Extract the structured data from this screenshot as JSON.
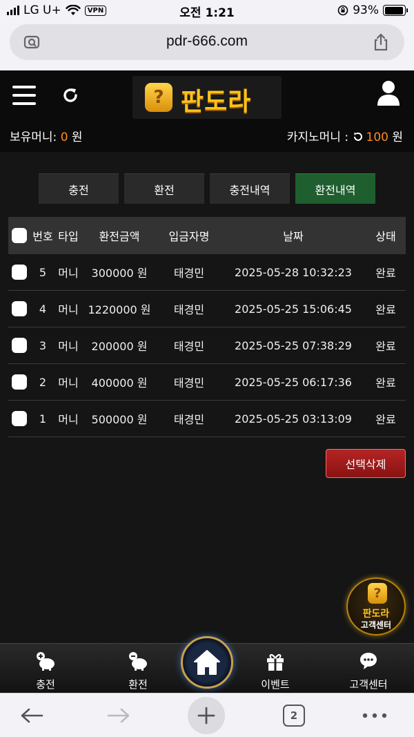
{
  "status_bar": {
    "carrier": "LG U+",
    "vpn": "VPN",
    "time": "오전 1:21",
    "battery_pct": "93%",
    "battery_level": 0.93
  },
  "browser": {
    "url": "pdr-666.com",
    "tab_count": "2"
  },
  "header": {
    "logo_text": "판도라",
    "logo_mark": "?",
    "wallet_label": "보유머니: ",
    "wallet_value": "0",
    "wallet_unit": " 원",
    "casino_label": "카지노머니 : ",
    "casino_value": "100",
    "casino_unit": " 원"
  },
  "tabs": [
    {
      "label": "충전",
      "active": false
    },
    {
      "label": "환전",
      "active": false
    },
    {
      "label": "충전내역",
      "active": false
    },
    {
      "label": "환전내역",
      "active": true
    }
  ],
  "table": {
    "headers": [
      "번호",
      "타입",
      "환전금액",
      "입금자명",
      "날짜",
      "상태"
    ],
    "rows": [
      {
        "no": "5",
        "type": "머니",
        "amount": "300000 원",
        "name": "태경민",
        "date": "2025-05-28 10:32:23",
        "status": "완료"
      },
      {
        "no": "4",
        "type": "머니",
        "amount": "1220000 원",
        "name": "태경민",
        "date": "2025-05-25 15:06:45",
        "status": "완료"
      },
      {
        "no": "3",
        "type": "머니",
        "amount": "200000 원",
        "name": "태경민",
        "date": "2025-05-25 07:38:29",
        "status": "완료"
      },
      {
        "no": "2",
        "type": "머니",
        "amount": "400000 원",
        "name": "태경민",
        "date": "2025-05-25 06:17:36",
        "status": "완료"
      },
      {
        "no": "1",
        "type": "머니",
        "amount": "500000 원",
        "name": "태경민",
        "date": "2025-05-25 03:13:09",
        "status": "완료"
      }
    ]
  },
  "delete_label": "선택삭제",
  "cs_float": {
    "brand": "판도라",
    "label": "고객센터",
    "mark": "?"
  },
  "bottom_nav": {
    "charge": "충전",
    "exchange": "환전",
    "event": "이벤트",
    "support": "고객센터"
  },
  "colors": {
    "accent_orange": "#ff8a1c",
    "active_tab": "#1f5e2f",
    "delete_red": "#b42424",
    "gold": "#ffc21a"
  },
  "icons": [
    "search-camera-icon",
    "share-icon",
    "hamburger-icon",
    "refresh-icon",
    "user-icon",
    "home-icon",
    "gift-icon",
    "chat-icon",
    "back-icon",
    "forward-icon",
    "plus-icon",
    "more-icon"
  ]
}
